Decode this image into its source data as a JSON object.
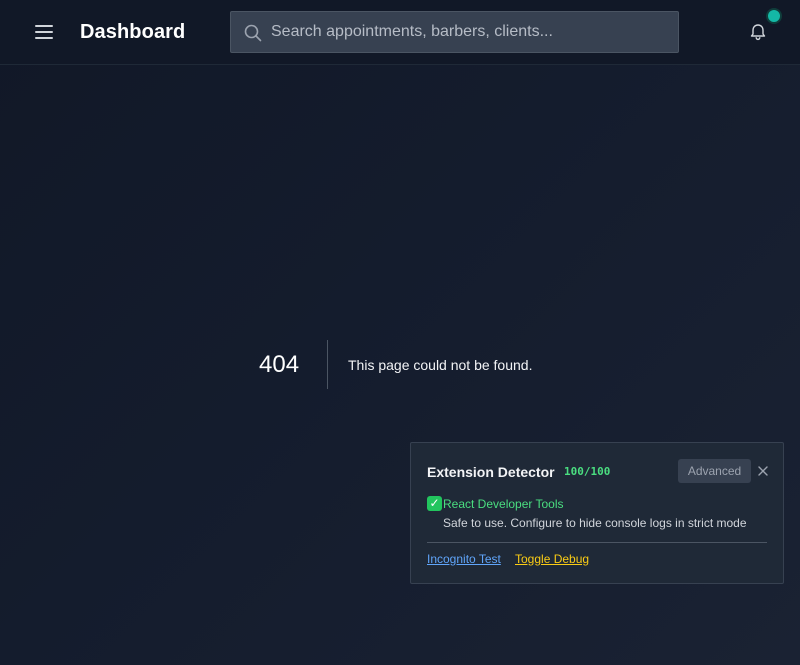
{
  "header": {
    "title": "Dashboard",
    "menu_icon": "hamburger-menu-icon",
    "search": {
      "placeholder": "Search appointments, barbers, clients...",
      "value": "",
      "icon": "search-icon"
    },
    "notifications_icon": "bell-icon",
    "status_dot_color": "#14b8a6"
  },
  "not_found": {
    "code": "404",
    "message": "This page could not be found."
  },
  "extension_panel": {
    "title": "Extension Detector",
    "score": "100/100",
    "advanced_label": "Advanced",
    "close_icon": "close-icon",
    "extension": {
      "status_icon": "check-mark-icon",
      "name": "React Developer Tools",
      "description": "Safe to use. Configure to hide console logs in strict mode"
    },
    "links": {
      "incognito": "Incognito Test",
      "debug": "Toggle Debug"
    }
  },
  "colors": {
    "background": "#111827",
    "success": "#4ade80",
    "link_blue": "#60a5fa",
    "link_yellow": "#facc15"
  }
}
